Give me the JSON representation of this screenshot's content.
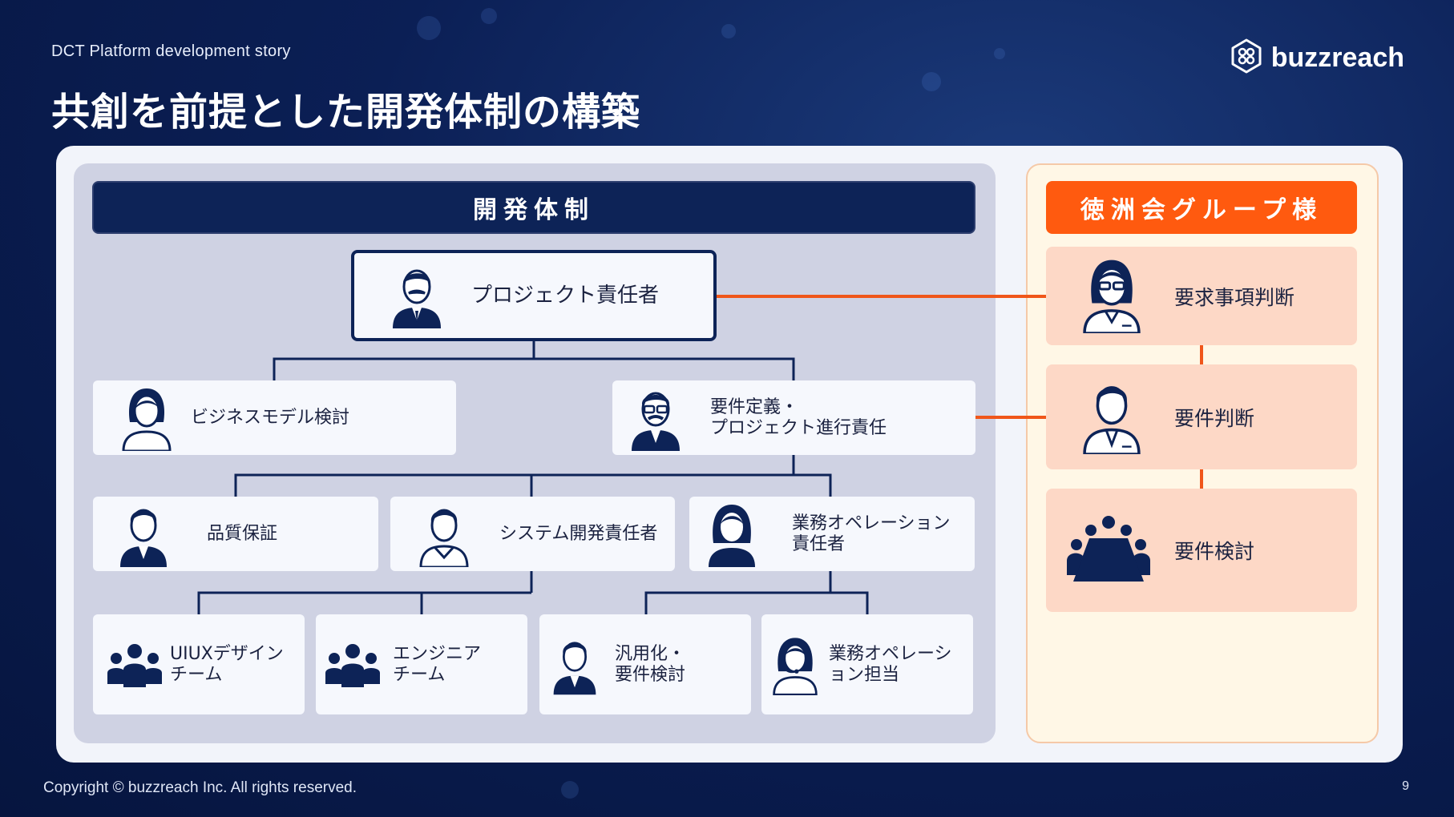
{
  "header": {
    "kicker": "DCT Platform development story",
    "title": "共創を前提とした開発体制の構築",
    "logo_text": "buzzreach"
  },
  "footer": {
    "copyright": "Copyright © buzzreach Inc. All rights reserved.",
    "page_number": "9"
  },
  "dev_team": {
    "heading": "開発体制",
    "project_lead": {
      "label": "プロジェクト責任者",
      "icon": "man-mustache-icon"
    },
    "level2": [
      {
        "label": "ビジネスモデル検討",
        "icon": "woman-icon"
      },
      {
        "label": "要件定義・\nプロジェクト進行責任",
        "icon": "man-glasses-icon"
      }
    ],
    "level3": [
      {
        "label": "品質保証",
        "icon": "man-suit-icon"
      },
      {
        "label": "システム開発責任者",
        "icon": "man-casual-icon"
      },
      {
        "label": "業務オペレーション\n責任者",
        "icon": "woman-short-icon"
      }
    ],
    "level4": [
      {
        "label": "UIUXデザイン\nチーム",
        "icon": "team-icon"
      },
      {
        "label": "エンジニア\nチーム",
        "icon": "team-icon"
      },
      {
        "label": "汎用化・\n要件検討",
        "icon": "man-icon"
      },
      {
        "label": "業務オペレーシ\nョン担当",
        "icon": "operator-headset-icon"
      }
    ]
  },
  "client": {
    "heading": "徳洲会グループ様",
    "items": [
      {
        "label": "要求事項判断",
        "icon": "woman-glasses-icon"
      },
      {
        "label": "要件判断",
        "icon": "man-icon"
      },
      {
        "label": "要件検討",
        "icon": "meeting-table-icon"
      }
    ]
  },
  "colors": {
    "navy": "#0d2357",
    "accent_orange": "#ff5a0f",
    "client_box": "#fdd8c6",
    "dev_panel": "#cfd2e3"
  }
}
